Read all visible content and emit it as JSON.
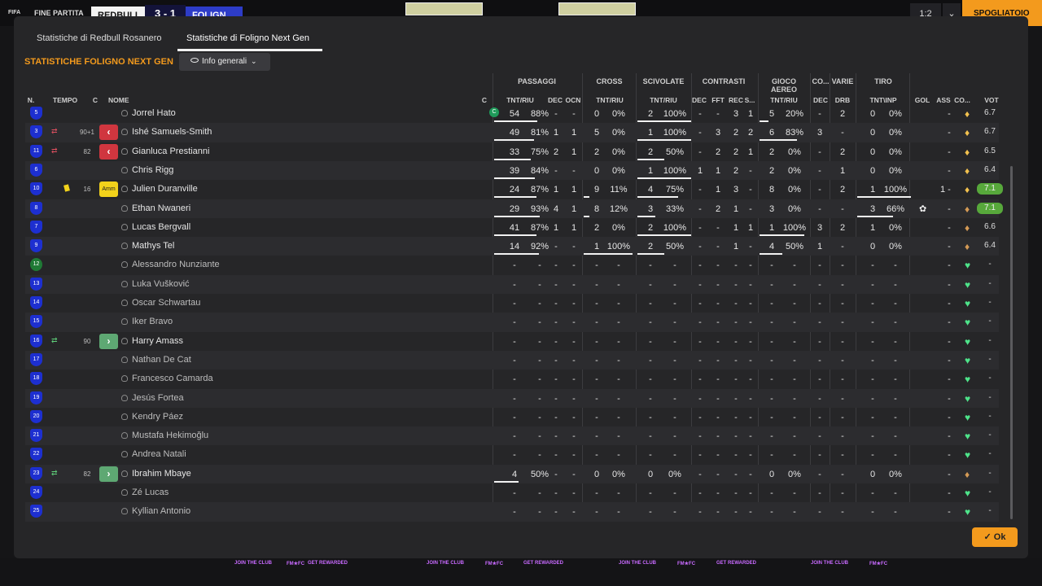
{
  "topbar": {
    "logo": "FIFA",
    "status": "FINE PARTITA",
    "home": "REDBULL",
    "score": "3 - 1",
    "away": "FOLIGN",
    "btn1": "1:2",
    "btn2": "⌄",
    "action": "SPOGLIATOIO"
  },
  "tabs": [
    "Statistiche di Redbull Rosanero",
    "Statistiche di Foligno Next Gen"
  ],
  "section_title": "STATISTICHE FOLIGNO NEXT GEN",
  "view_dropdown": "Info generali",
  "groups": [
    "PASSAGGI",
    "CROSS",
    "SCIVOLATE",
    "CONTRASTI",
    "GIOCO AEREO",
    "CO...",
    "VARIE",
    "TIRO"
  ],
  "columns": {
    "num": "N.",
    "tempo": "TEMPO",
    "c": "C",
    "nome": "NOME",
    "c2": "C",
    "pass": "TNT/RIU",
    "dec": "DEC",
    "ocn": "OCN",
    "cross": "TNT/RIU",
    "sciv": "TNT/RIU",
    "cdec": "DEC",
    "fft": "FFT",
    "rec": "REC",
    "cs": "S...",
    "aereo": "TNT/RIU",
    "codec": "DEC",
    "drb": "DRB",
    "tiro": "TNT\\INP",
    "gol": "GOL",
    "ass": "ASS",
    "co": "CO...",
    "vot": "VOT"
  },
  "players": [
    {
      "num": "5",
      "name": "Jorrel Hato",
      "captain": "C",
      "pt": "54",
      "pp": "88%",
      "pdec": "-",
      "pocn": "-",
      "ct": "0",
      "cp": "0%",
      "st": "2",
      "sp": "100%",
      "cdec": "-",
      "fft": "-",
      "rec": "3",
      "cs": "1",
      "at": "5",
      "ap": "20%",
      "codec": "-",
      "drb": "2",
      "tt": "0",
      "tp": "0%",
      "gol": "",
      "ass": "-",
      "vot": "6.7"
    },
    {
      "num": "3",
      "name": "Ishé Samuels-Smith",
      "ev": "⇄",
      "evtype": "out",
      "mins": "90+1",
      "badge": "‹",
      "pt": "49",
      "pp": "81%",
      "pdec": "1",
      "pocn": "1",
      "ct": "5",
      "cp": "0%",
      "st": "1",
      "sp": "100%",
      "cdec": "-",
      "fft": "3",
      "rec": "2",
      "cs": "2",
      "at": "6",
      "ap": "83%",
      "codec": "3",
      "drb": "-",
      "tt": "0",
      "tp": "0%",
      "gol": "",
      "ass": "-",
      "vot": "6.7"
    },
    {
      "num": "11",
      "name": "Gianluca Prestianni",
      "ev": "⇄",
      "evtype": "out",
      "mins": "82",
      "badge": "‹",
      "pt": "33",
      "pp": "75%",
      "pdec": "2",
      "pocn": "1",
      "ct": "2",
      "cp": "0%",
      "st": "2",
      "sp": "50%",
      "cdec": "-",
      "fft": "2",
      "rec": "2",
      "cs": "1",
      "at": "2",
      "ap": "0%",
      "codec": "-",
      "drb": "2",
      "tt": "0",
      "tp": "0%",
      "gol": "",
      "ass": "-",
      "vot": "6.5"
    },
    {
      "num": "6",
      "name": "Chris Rigg",
      "pt": "39",
      "pp": "84%",
      "pdec": "-",
      "pocn": "-",
      "ct": "0",
      "cp": "0%",
      "st": "1",
      "sp": "100%",
      "cdec": "1",
      "fft": "1",
      "rec": "2",
      "cs": "-",
      "at": "2",
      "ap": "0%",
      "codec": "-",
      "drb": "1",
      "tt": "0",
      "tp": "0%",
      "gol": "",
      "ass": "-",
      "vot": "6.4"
    },
    {
      "num": "10",
      "name": "Julien Duranville",
      "card": "yellow",
      "mins": "16",
      "badge": "Amm",
      "pt": "24",
      "pp": "87%",
      "pdec": "1",
      "pocn": "1",
      "ct": "9",
      "cp": "11%",
      "st": "4",
      "sp": "75%",
      "cdec": "-",
      "fft": "1",
      "rec": "3",
      "cs": "-",
      "at": "8",
      "ap": "0%",
      "codec": "-",
      "drb": "2",
      "tt": "1",
      "tp": "100%",
      "gol": "1",
      "ass": "-",
      "vot": "7.1"
    },
    {
      "num": "8",
      "name": "Ethan Nwaneri",
      "pt": "29",
      "pp": "93%",
      "pdec": "4",
      "pocn": "1",
      "ct": "8",
      "cp": "12%",
      "st": "3",
      "sp": "33%",
      "cdec": "-",
      "fft": "2",
      "rec": "1",
      "cs": "-",
      "at": "3",
      "ap": "0%",
      "codec": "-",
      "drb": "-",
      "tt": "3",
      "tp": "66%",
      "gol": "",
      "potm": "✿",
      "ass": "-",
      "vot": "7.1"
    },
    {
      "num": "7",
      "name": "Lucas Bergvall",
      "pt": "41",
      "pp": "87%",
      "pdec": "1",
      "pocn": "1",
      "ct": "2",
      "cp": "0%",
      "st": "2",
      "sp": "100%",
      "cdec": "-",
      "fft": "-",
      "rec": "1",
      "cs": "1",
      "at": "1",
      "ap": "100%",
      "codec": "3",
      "drb": "2",
      "tt": "1",
      "tp": "0%",
      "gol": "",
      "ass": "-",
      "vot": "6.6"
    },
    {
      "num": "9",
      "name": "Mathys Tel",
      "pt": "14",
      "pp": "92%",
      "pdec": "-",
      "pocn": "-",
      "ct": "1",
      "cp": "100%",
      "st": "2",
      "sp": "50%",
      "cdec": "-",
      "fft": "-",
      "rec": "1",
      "cs": "-",
      "at": "4",
      "ap": "50%",
      "codec": "1",
      "drb": "-",
      "tt": "0",
      "tp": "0%",
      "gol": "",
      "ass": "-",
      "vot": "6.4"
    },
    {
      "num": "12",
      "name": "Alessandro Nunziante",
      "sub": true
    },
    {
      "num": "13",
      "name": "Luka Vušković",
      "sub": true
    },
    {
      "num": "14",
      "name": "Oscar Schwartau",
      "sub": true
    },
    {
      "num": "15",
      "name": "Iker Bravo",
      "sub": true
    },
    {
      "num": "16",
      "name": "Harry Amass",
      "ev": "⇄",
      "evtype": "in",
      "mins": "90",
      "badge": "›"
    },
    {
      "num": "17",
      "name": "Nathan De Cat",
      "sub": true
    },
    {
      "num": "18",
      "name": "Francesco Camarda",
      "sub": true
    },
    {
      "num": "19",
      "name": "Jesús Fortea",
      "sub": true
    },
    {
      "num": "20",
      "name": "Kendry Páez",
      "sub": true
    },
    {
      "num": "21",
      "name": "Mustafa Hekimoğlu",
      "sub": true
    },
    {
      "num": "22",
      "name": "Andrea Natali",
      "sub": true
    },
    {
      "num": "23",
      "name": "Ibrahim Mbaye",
      "ev": "⇄",
      "evtype": "in",
      "mins": "82",
      "badge": "›",
      "pt": "4",
      "pp": "50%",
      "pdec": "-",
      "pocn": "-",
      "ct": "0",
      "cp": "0%",
      "st": "0",
      "sp": "0%",
      "cdec": "-",
      "fft": "-",
      "rec": "-",
      "cs": "-",
      "at": "0",
      "ap": "0%",
      "codec": "-",
      "drb": "-",
      "tt": "0",
      "tp": "0%",
      "gol": "",
      "ass": "-",
      "vot": "-"
    },
    {
      "num": "24",
      "name": "Zé Lucas",
      "sub": true
    },
    {
      "num": "25",
      "name": "Kyllian Antonio",
      "sub": true
    }
  ],
  "ok_button": "Ok",
  "ads": [
    "JOIN THE CLUB",
    "FM★FC",
    "GET REWARDED"
  ],
  "colors": {
    "accent": "#f39a1d",
    "shirt": "#1d2fd0",
    "rating_high": "#57a83b",
    "sub_out": "#d0363f",
    "sub_in": "#5ea873"
  }
}
